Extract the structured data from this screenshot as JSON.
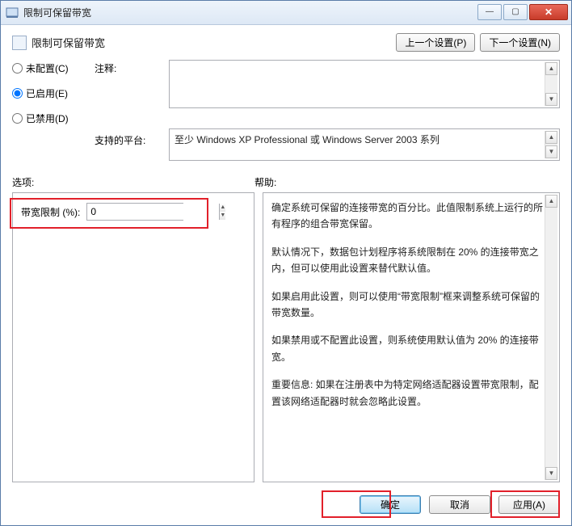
{
  "window": {
    "title": "限制可保留带宽"
  },
  "header": {
    "title": "限制可保留带宽",
    "prev": "上一个设置(P)",
    "next": "下一个设置(N)"
  },
  "radios": {
    "unconfigured": "未配置(C)",
    "enabled": "已启用(E)",
    "disabled": "已禁用(D)"
  },
  "labels": {
    "comment": "注释:",
    "platform": "支持的平台:",
    "options": "选项:",
    "help": "帮助:",
    "bandwidth": "带宽限制 (%):"
  },
  "platform_text": "至少 Windows XP Professional 或 Windows Server 2003 系列",
  "bandwidth_value": "0",
  "help_paras": [
    "确定系统可保留的连接带宽的百分比。此值限制系统上运行的所有程序的组合带宽保留。",
    "默认情况下，数据包计划程序将系统限制在 20% 的连接带宽之内，但可以使用此设置来替代默认值。",
    "如果启用此设置，则可以使用“带宽限制”框来调整系统可保留的带宽数量。",
    "如果禁用或不配置此设置，则系统使用默认值为 20% 的连接带宽。",
    "重要信息: 如果在注册表中为特定网络适配器设置带宽限制，配置该网络适配器时就会忽略此设置。"
  ],
  "buttons": {
    "ok": "确定",
    "cancel": "取消",
    "apply": "应用(A)"
  }
}
